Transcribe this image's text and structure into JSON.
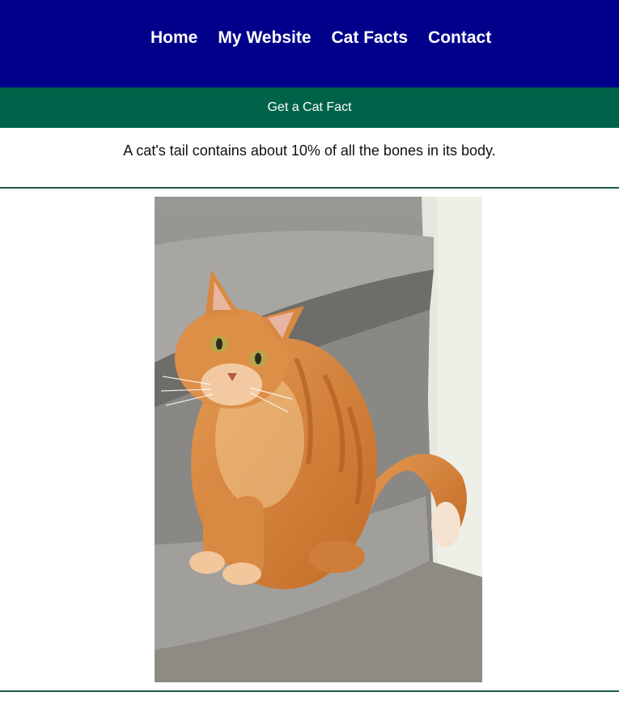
{
  "nav": {
    "items": [
      {
        "label": "Home"
      },
      {
        "label": "My Website"
      },
      {
        "label": "Cat Facts"
      },
      {
        "label": "Contact"
      }
    ]
  },
  "fact_section": {
    "button_label": "Get a Cat Fact",
    "fact": "A cat's tail contains about 10% of all the bones in its body."
  },
  "photo": {
    "subject": "orange-tabby-cat-on-stairs"
  },
  "colors": {
    "nav_bg": "#00008b",
    "fact_bar_bg": "#006349",
    "rule": "#1f5b4f"
  }
}
